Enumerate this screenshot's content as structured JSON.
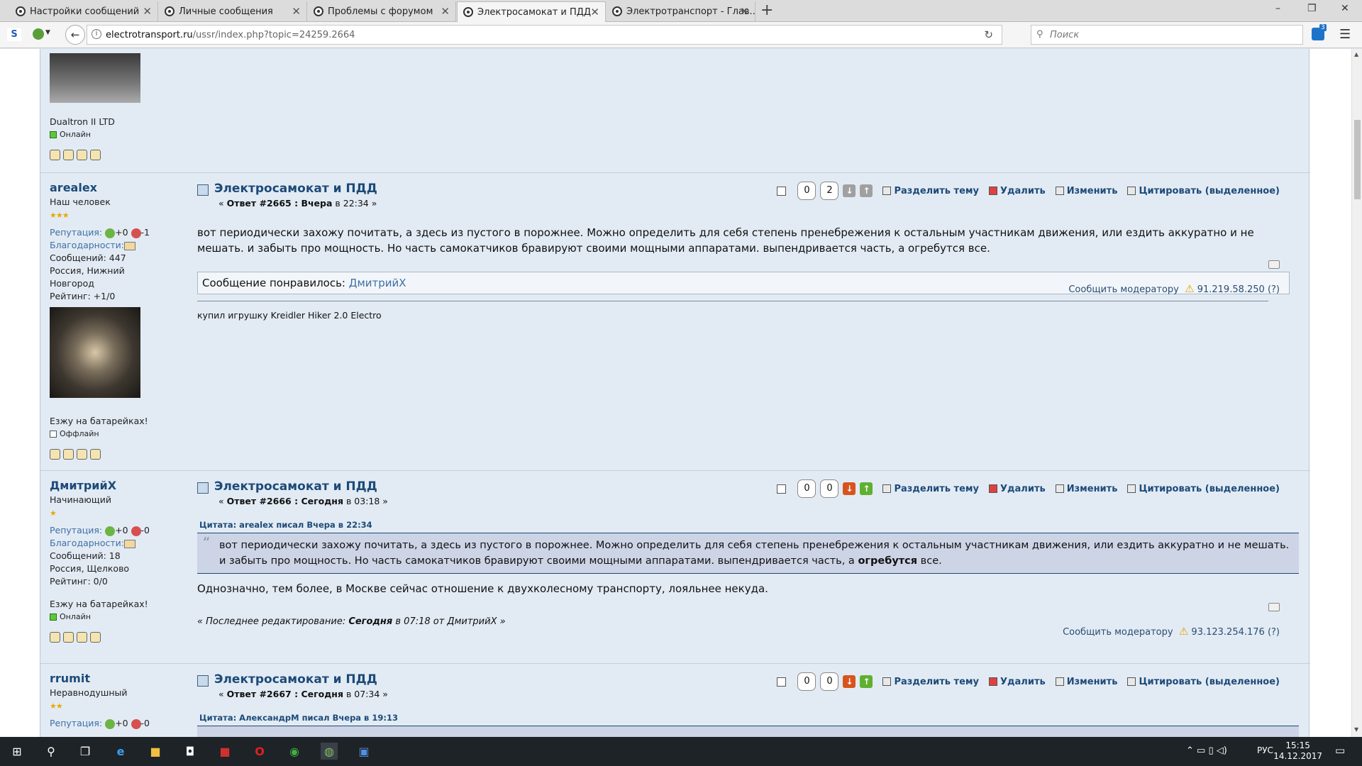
{
  "browser": {
    "tabs": [
      {
        "label": "Настройки сообщений"
      },
      {
        "label": "Личные сообщения"
      },
      {
        "label": "Проблемы с форумом"
      },
      {
        "label": "Электросамокат и ПДД"
      },
      {
        "label": "Электротранспорт - Глав..."
      }
    ],
    "url_host": "electrotransport.ru",
    "url_path": "/ussr/index.php?topic=24259.2664",
    "search_placeholder": "Поиск",
    "badge_count": "3"
  },
  "posts": [
    {
      "poster_signature_top": "Dualtron II LTD",
      "status": "Онлайн"
    },
    {
      "name": "arealex",
      "title": "Наш человек",
      "stars": "★★★",
      "reputation_label": "Репутация:",
      "rep_plus": "+0",
      "rep_minus": "-1",
      "thanks_label": "Благодарности:",
      "messages": "Сообщений: 447",
      "location": "Россия, Нижний Новгород",
      "rating": "Рейтинг: +1/0",
      "personal_text": "Езжу на батарейках!",
      "status": "Оффлайн",
      "subject": "Электросамокат и ПДД",
      "meta_prefix": "« ",
      "meta_reply": "Ответ #2665 : Вчера",
      "meta_time": " в 22:34 »",
      "vote_down": "0",
      "vote_up": "2",
      "text": "вот периодически захожу почитать, а здесь из пустого в порожнее. Можно определить для себя степень пренебрежения к остальным участникам движения, или ездить аккуратно и не мешать. и забыть про мощность.   Но часть самокатчиков бравируют своими мощными аппаратами. выпендривается часть, а огребутся все.",
      "liked_label": "Сообщение понравилось: ",
      "liked_user": "ДмитрийХ",
      "report": "Сообщить модератору",
      "ip": "91.219.58.250",
      "ip_q": "(?)",
      "signature": "купил игрушку Kreidler Hiker 2.0 Electro"
    },
    {
      "name": "ДмитрийХ",
      "title": "Начинающий",
      "stars": "★",
      "reputation_label": "Репутация:",
      "rep_plus": "+0",
      "rep_minus": "-0",
      "thanks_label": "Благодарности:",
      "messages": "Сообщений: 18",
      "location": "Россия, Щелково",
      "rating": "Рейтинг: 0/0",
      "personal_text": "Езжу на батарейках!",
      "status": "Онлайн",
      "subject": "Электросамокат и ПДД",
      "meta_prefix": "« ",
      "meta_reply": "Ответ #2666 : Сегодня",
      "meta_time": " в 03:18 »",
      "vote_down": "0",
      "vote_up": "0",
      "quote_header": "Цитата: arealex писал Вчера в 22:34",
      "quote_text_a": "вот периодически захожу почитать, а здесь из пустого в порожнее. Можно определить для себя степень пренебрежения к остальным участникам движения, или ездить аккуратно и не мешать. и забыть про мощность.   Но часть самокатчиков бравируют своими мощными аппаратами. выпендривается часть, а ",
      "quote_text_bold": "огребутся",
      "quote_text_b": " все.",
      "text": "Однозначно, тем более, в Москве сейчас отношение к двухколесному транспорту, лояльнее некуда.",
      "edited_a": "« Последнее редактирование: ",
      "edited_b": "Сегодня",
      "edited_c": " в 07:18 от ДмитрийХ »",
      "report": "Сообщить модератору",
      "ip": "93.123.254.176",
      "ip_q": "(?)"
    },
    {
      "name": "rrumit",
      "title": "Неравнодушный",
      "stars": "★★",
      "reputation_label": "Репутация:",
      "rep_plus": "+0",
      "rep_minus": "-0",
      "subject": "Электросамокат и ПДД",
      "meta_prefix": "« ",
      "meta_reply": "Ответ #2667 : Сегодня",
      "meta_time": " в 07:34 »",
      "vote_down": "0",
      "vote_up": "0",
      "quote_header": "Цитата: АлександрМ писал Вчера в 19:13"
    }
  ],
  "actions": {
    "split": "Разделить тему",
    "delete": "Удалить",
    "edit": "Изменить",
    "quote": "Цитировать (выделенное)"
  },
  "taskbar": {
    "lang": "РУС",
    "time": "15:15",
    "date": "14.12.2017"
  }
}
